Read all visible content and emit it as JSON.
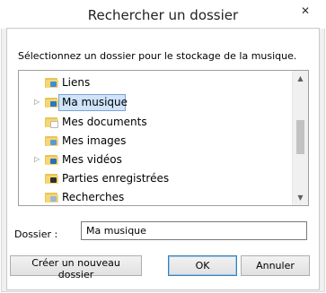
{
  "window": {
    "title": "Rechercher un dossier",
    "close_glyph": "✕"
  },
  "instruction": "Sélectionnez un dossier pour le stockage de la musique.",
  "tree": {
    "items": [
      {
        "label": "Liens",
        "icon": "links-folder-icon",
        "badge_color": "#3e8fd8"
      },
      {
        "label": "Ma musique",
        "icon": "music-folder-icon",
        "badge_color": "#2c77c9",
        "selected": true,
        "has_children": true
      },
      {
        "label": "Mes documents",
        "icon": "documents-folder-icon",
        "badge_color": "#ffffff"
      },
      {
        "label": "Mes images",
        "icon": "pictures-folder-icon",
        "badge_color": "#5b9bd5"
      },
      {
        "label": "Mes vidéos",
        "icon": "videos-folder-icon",
        "badge_color": "#2d6fb5",
        "has_children": true
      },
      {
        "label": "Parties enregistrées",
        "icon": "saved-games-folder-icon",
        "badge_color": "#303030"
      },
      {
        "label": "Recherches",
        "icon": "searches-folder-icon",
        "badge_color": "#9ab8d8"
      }
    ],
    "expander_glyph": "▷",
    "scroll_up_glyph": "▲",
    "scroll_down_glyph": "▼"
  },
  "folder_field": {
    "label": "Dossier :",
    "value": "Ma musique"
  },
  "buttons": {
    "new_folder": "Créer un nouveau dossier",
    "ok": "OK",
    "cancel": "Annuler"
  },
  "colors": {
    "selection_bg": "#cfe4fa",
    "selection_border": "#7da2ce",
    "folder_yellow": "#f7d774"
  }
}
